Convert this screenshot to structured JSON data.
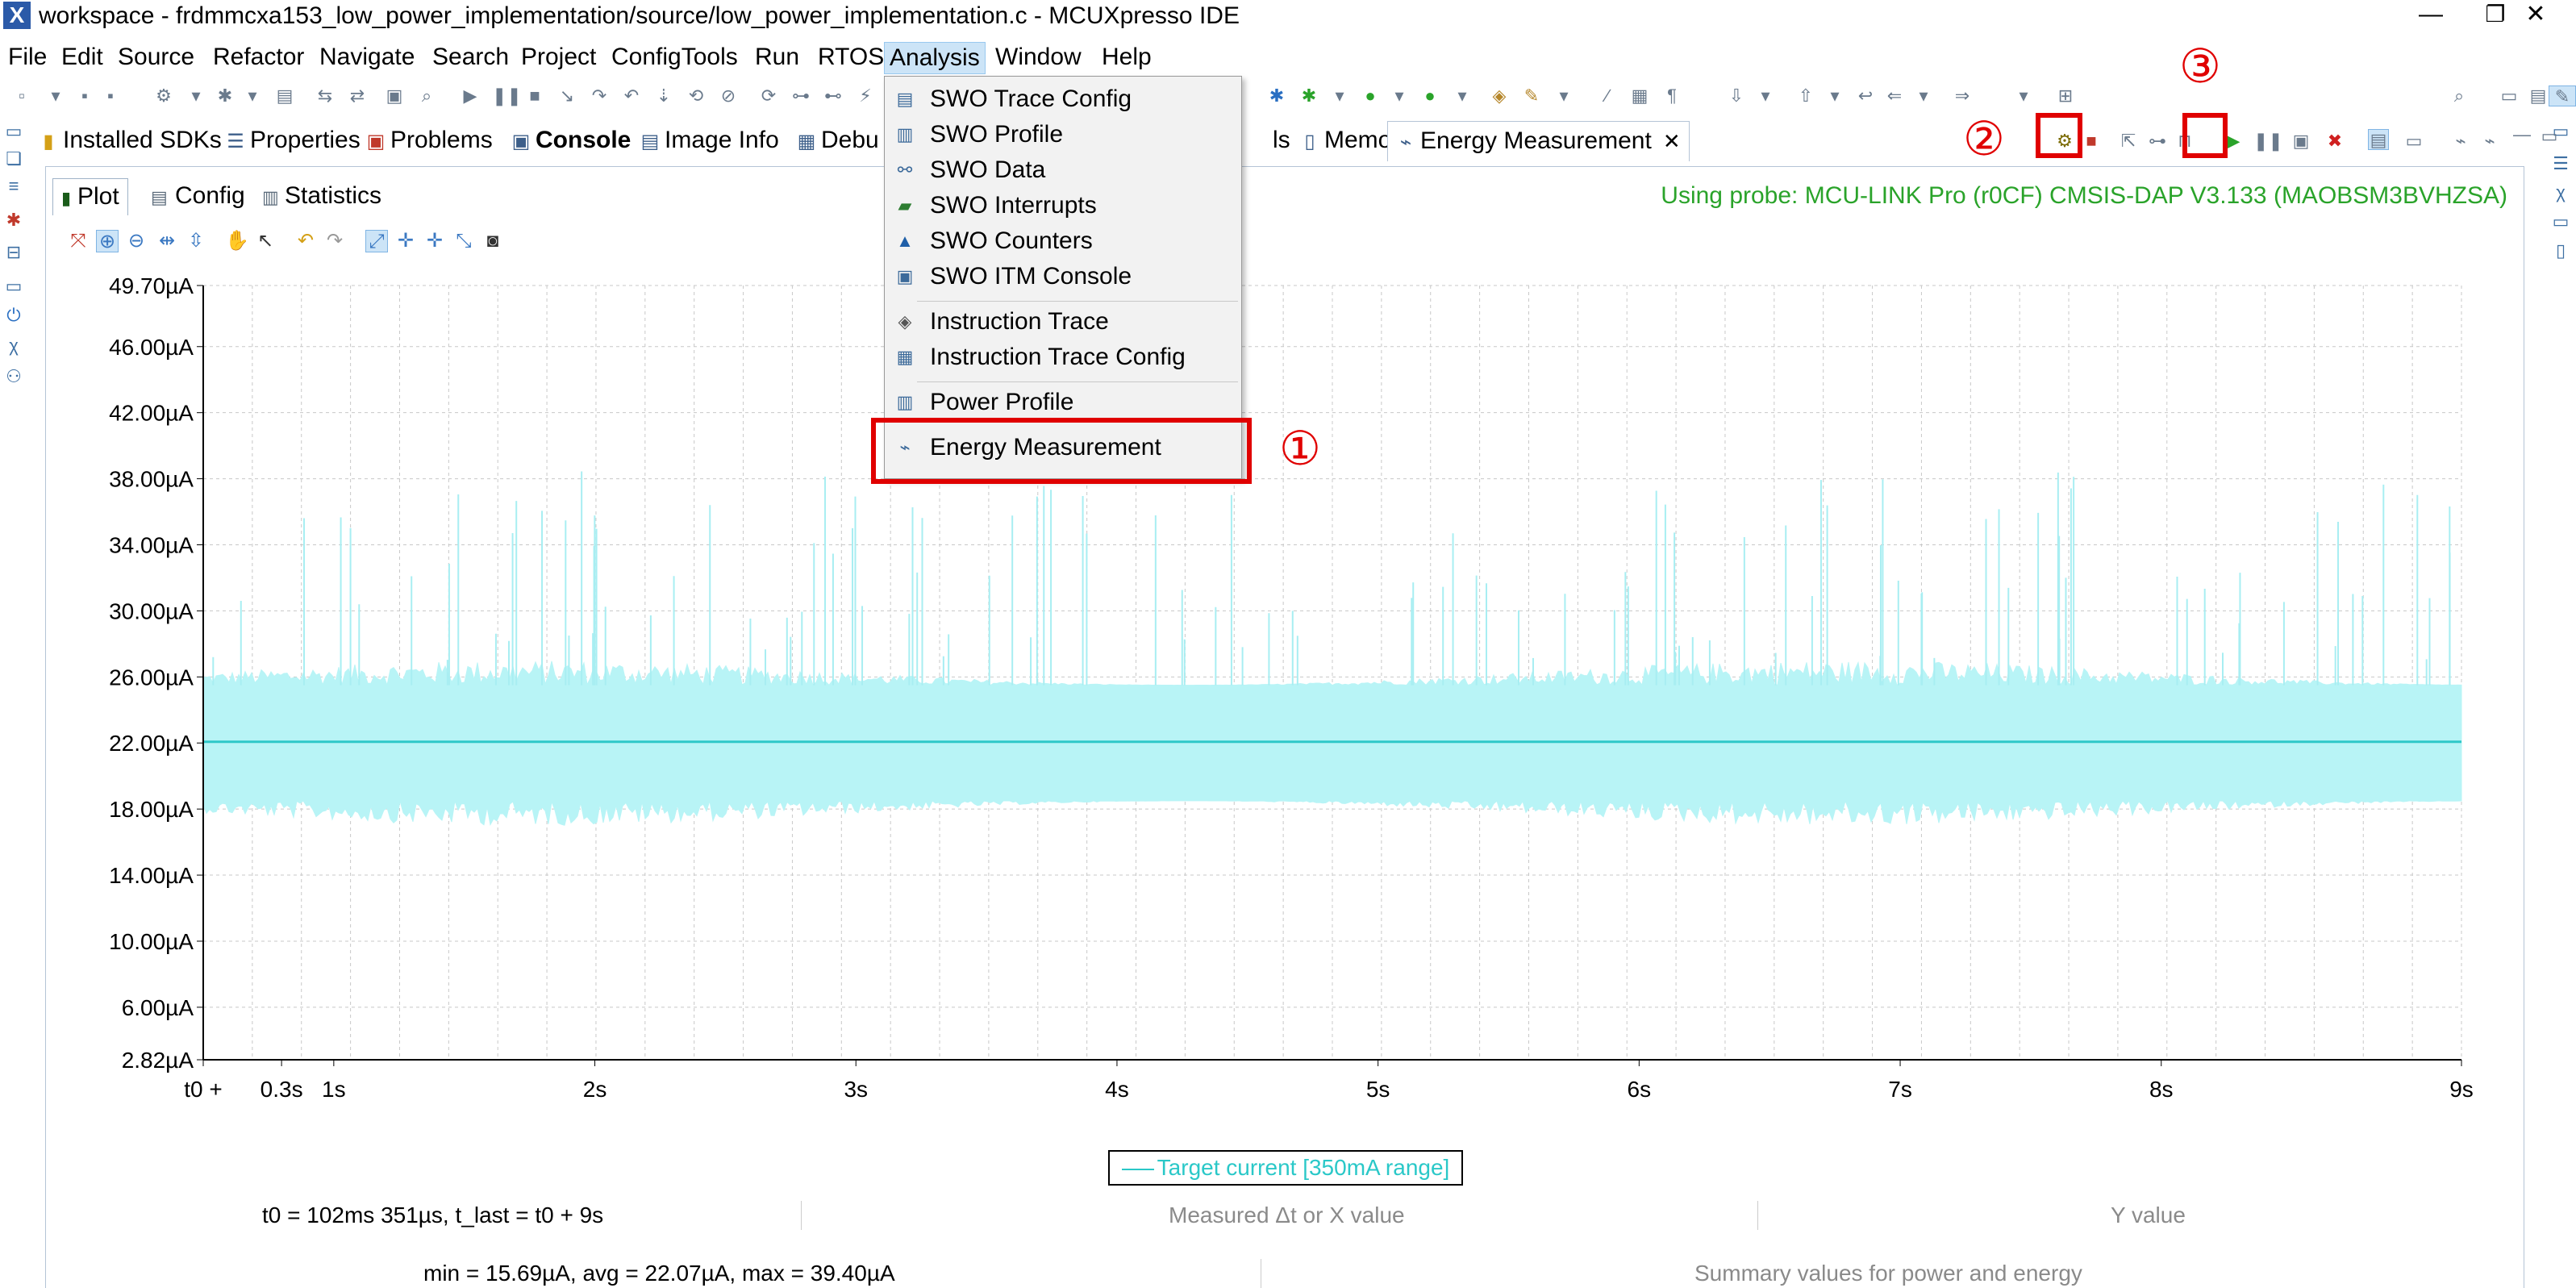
{
  "window": {
    "title": "workspace - frdmmcxa153_low_power_implementation/source/low_power_implementation.c - MCUXpresso IDE",
    "minimize": "—",
    "restore": "❐",
    "close": "✕"
  },
  "menubar": [
    "File",
    "Edit",
    "Source",
    "Refactor",
    "Navigate",
    "Search",
    "Project",
    "ConfigTools",
    "Run",
    "RTOS",
    "Analysis",
    "Window",
    "Help"
  ],
  "view_tabs": {
    "installed_sdks": "Installed SDKs",
    "properties": "Properties",
    "problems": "Problems",
    "console": "Console",
    "image_info": "Image Info",
    "debug": "Debu",
    "debug_tail": "ls",
    "memory": "Memory",
    "energy": "Energy Measurement",
    "energy_close": "✕"
  },
  "sub_tabs": [
    "Plot",
    "Config",
    "Statistics"
  ],
  "probe_status": "Using probe: MCU-LINK Pro (r0CF) CMSIS-DAP V3.133 (MAOBSM3BVHZSA)",
  "analysis_menu": {
    "items": [
      {
        "label": "SWO Trace Config",
        "icon": "swo-trace-config-icon"
      },
      {
        "label": "SWO Profile",
        "icon": "swo-profile-icon"
      },
      {
        "label": "SWO Data",
        "icon": "swo-data-icon"
      },
      {
        "label": "SWO Interrupts",
        "icon": "swo-interrupts-icon"
      },
      {
        "label": "SWO Counters",
        "icon": "swo-counters-icon"
      },
      {
        "label": "SWO ITM Console",
        "icon": "swo-itm-console-icon"
      },
      {
        "label": "Instruction Trace",
        "icon": "instruction-trace-icon"
      },
      {
        "label": "Instruction Trace Config",
        "icon": "instruction-trace-config-icon"
      },
      {
        "label": "Power Profile",
        "icon": "power-profile-icon"
      },
      {
        "label": "Energy Measurement",
        "icon": "energy-measurement-icon"
      }
    ]
  },
  "annotations": {
    "step1": "①",
    "step2": "②",
    "step3": "③",
    "color": "#e00000"
  },
  "chart_data": {
    "type": "line",
    "x_tick_labels": [
      "t0 +",
      "0.3s",
      "1s",
      "2s",
      "3s",
      "4s",
      "5s",
      "6s",
      "7s",
      "8s",
      "9s"
    ],
    "x_ticks_s": [
      0,
      0.3,
      0.5,
      1.5,
      2.5,
      3.5,
      4.5,
      5.5,
      6.5,
      7.5,
      8.65
    ],
    "x_range_s": [
      0,
      8.65
    ],
    "y_tick_labels": [
      "49.70µA",
      "46.00µA",
      "42.00µA",
      "38.00µA",
      "34.00µA",
      "30.00µA",
      "26.00µA",
      "22.00µA",
      "18.00µA",
      "14.00µA",
      "10.00µA",
      "6.00µA",
      "2.82µA"
    ],
    "y_ticks_uA": [
      49.7,
      46,
      42,
      38,
      34,
      30,
      26,
      22,
      18,
      14,
      10,
      6,
      2.82
    ],
    "y_range_uA": [
      2.82,
      49.7
    ],
    "grid": true,
    "legend_position": "bottom-center",
    "series": [
      {
        "name": "Target current [350mA range]",
        "color": "#2ec8c8",
        "fill_color": "#b8f4f6",
        "average_uA": 22.07,
        "band_uA": [
          18.5,
          25.5
        ],
        "band_wide_uA": [
          17,
          27
        ],
        "spike_peak_uA": 38.5
      }
    ]
  },
  "stats": {
    "t0_line": "t0 = 102ms 351µs, t_last = t0 + 9s",
    "delta_placeholder": "Measured Δt or X value",
    "y_placeholder": "Y value",
    "min_avg_max": "min = 15.69µA, avg = 22.07µA, max = 39.40µA",
    "summary_placeholder": "Summary values for power and energy"
  }
}
